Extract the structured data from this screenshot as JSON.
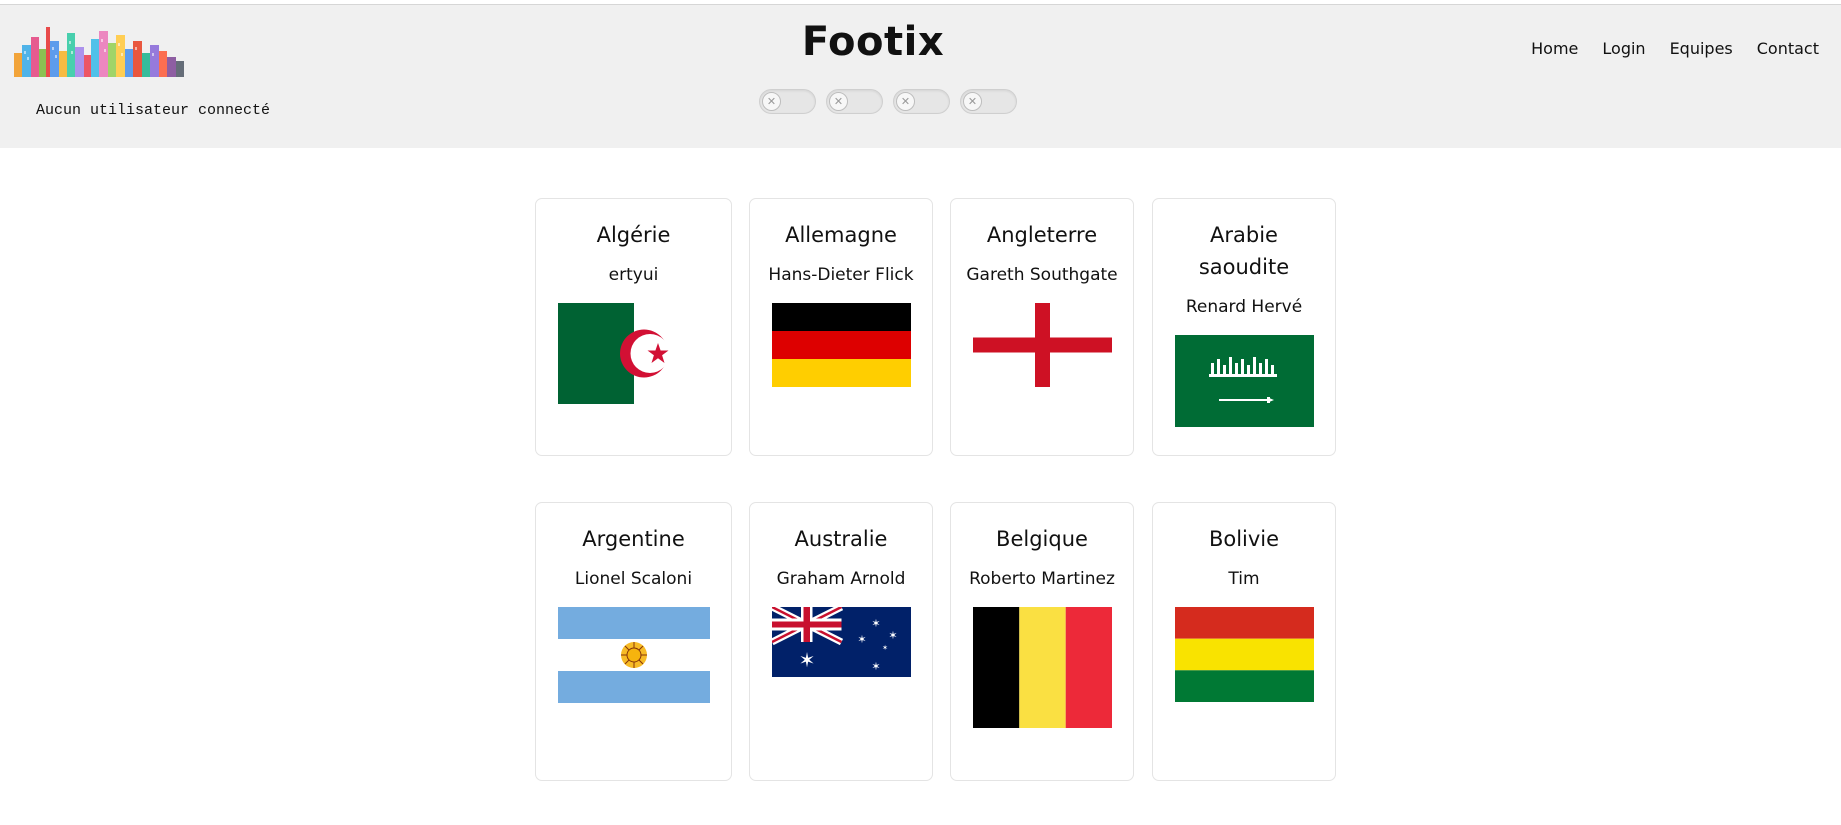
{
  "header": {
    "title": "Footix",
    "user_status": "Aucun utilisateur connecté",
    "background": "#f0f0f0",
    "toggles": [
      {
        "state": "off",
        "icon": "x-icon"
      },
      {
        "state": "off",
        "icon": "x-icon"
      },
      {
        "state": "off",
        "icon": "x-icon"
      },
      {
        "state": "off",
        "icon": "x-icon"
      }
    ]
  },
  "nav": {
    "items": [
      {
        "label": "Home"
      },
      {
        "label": "Login"
      },
      {
        "label": "Equipes"
      },
      {
        "label": "Contact"
      }
    ]
  },
  "teams": [
    {
      "name": "Algérie",
      "coach": "ertyui",
      "flag_icon": "algeria-flag-icon"
    },
    {
      "name": "Allemagne",
      "coach": "Hans-Dieter Flick",
      "flag_icon": "germany-flag-icon"
    },
    {
      "name": "Angleterre",
      "coach": "Gareth Southgate",
      "flag_icon": "england-flag-icon"
    },
    {
      "name": "Arabie saoudite",
      "coach": "Renard Hervé",
      "flag_icon": "saudi-arabia-flag-icon"
    },
    {
      "name": "Argentine",
      "coach": "Lionel Scaloni",
      "flag_icon": "argentina-flag-icon"
    },
    {
      "name": "Australie",
      "coach": "Graham Arnold",
      "flag_icon": "australia-flag-icon"
    },
    {
      "name": "Belgique",
      "coach": "Roberto Martinez",
      "flag_icon": "belgium-flag-icon"
    },
    {
      "name": "Bolivie",
      "coach": "Tim",
      "flag_icon": "bolivia-flag-icon"
    }
  ]
}
